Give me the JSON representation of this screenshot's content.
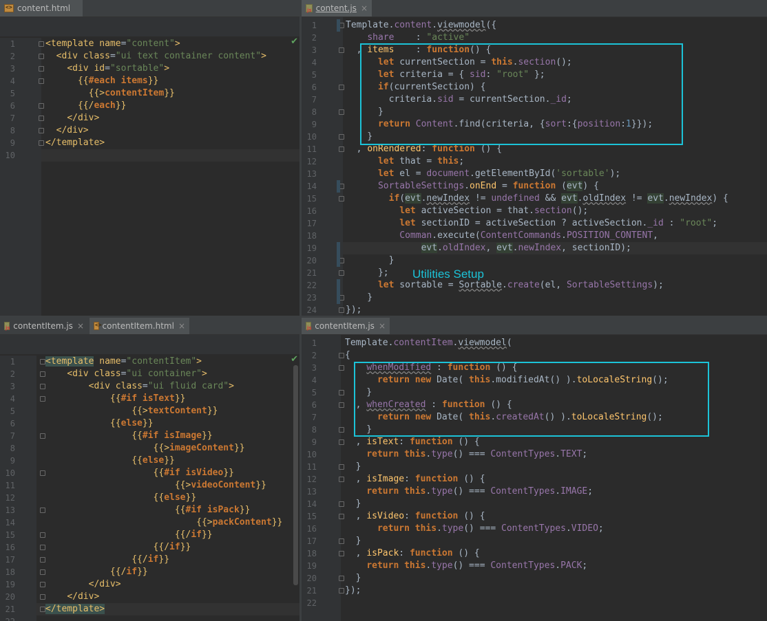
{
  "panes": {
    "top_left": {
      "tabs": [
        {
          "label": "content.html",
          "icon": "html-file-icon",
          "active": true
        }
      ],
      "lines": [
        "<span class='tag'>&lt;template</span> <span class='tag'>name</span>=<span class='str'>\"content\"</span><span class='tag'>&gt;</span>",
        "  <span class='tag'>&lt;div</span> <span class='tag'>class</span>=<span class='str'>\"ui text container content\"</span><span class='tag'>&gt;</span>",
        "    <span class='tag'>&lt;div</span> <span class='tag'>id</span>=<span class='str'>\"sortable\"</span><span class='tag'>&gt;</span>",
        "      <span class='tag'>{{</span><span class='kw'>#each</span> <span class='kw'>items</span><span class='tag'>}}</span>",
        "        <span class='tag'>{{&gt;</span><span class='kw'>contentItem</span><span class='tag'>}}</span>",
        "      <span class='tag'>{{/</span><span class='kw'>each</span><span class='tag'>}}</span>",
        "    <span class='tag'>&lt;/div&gt;</span>",
        "  <span class='tag'>&lt;/div&gt;</span>",
        "<span class='tag'>&lt;/template&gt;</span>",
        ""
      ]
    },
    "top_right": {
      "tabs": [
        {
          "label": "content.js",
          "icon": "js-file-icon",
          "active": true
        }
      ],
      "lines": [
        "Template.<span class='fld'>content</span>.<span class='ul'>viewmodel</span>({",
        "    <span class='fld'>share</span>    : <span class='str'>\"active\"</span>",
        "  , <span class='fn'>items</span>    : <span class='kw'>function</span>() {",
        "      <span class='kw'>let</span> currentSection = <span class='kw'>this</span>.<span class='fld'>section</span>();",
        "      <span class='kw'>let</span> criteria = { <span class='fld'>sid</span>: <span class='str'>\"root\"</span> };",
        "      <span class='kw'>if</span>(currentSection) {",
        "        criteria.<span class='fld'>sid</span> = currentSection.<span class='fld'>_id</span>;",
        "      }",
        "      <span class='kw'>return</span> <span class='cls'>Content</span>.find(criteria, {<span class='fld'>sort</span>:{<span class='fld'>position</span>:<span class='num'>1</span>}});",
        "    }",
        "  , <span class='fn'>onRendered</span>: <span class='kw'>function</span> () {",
        "      <span class='kw'>let</span> that = <span class='kw'>this</span>;",
        "      <span class='kw'>let</span> el = <span class='cls'>document</span>.getElementById(<span class='str'>'sortable'</span>);",
        "      <span class='cls'>SortableSettings</span>.<span class='fn'>onEnd</span> = <span class='kw'>function</span> (<span class='hl-param'>evt</span>) {",
        "        <span class='kw'>if</span>(<span class='hl-param'>evt</span>.<span class='ul'>newIndex</span> != <span class='cls'>undefined</span> &amp;&amp; <span class='hl-param'>evt</span>.<span class='ul'>oldIndex</span> != <span class='hl-param'>evt</span>.<span class='ul'>newIndex</span>) {",
        "          <span class='kw'>let</span> activeSection = that.<span class='fld'>section</span>();",
        "          <span class='kw'>let</span> sectionID = activeSection ? activeSection.<span class='fld'>_id</span> : <span class='str'>\"root\"</span>;",
        "          <span class='cls'>Comman</span>.execute(<span class='cls'>ContentCommands</span>.<span class='fld'>POSITION_CONTENT</span>,",
        "              <span class='hl-param'>evt</span>.<span class='fld'>oldIndex</span>, <span class='hl-param'>evt</span>.<span class='fld'>newIndex</span>, sectionID);",
        "        }",
        "      };",
        "      <span class='kw'>let</span> sortable = <span class='ul'>Sortable</span>.<span class='fld'>create</span>(el, <span class='cls'>SortableSettings</span>);",
        "    }",
        "});"
      ],
      "annotation": "Utilities Setup"
    },
    "bottom_left": {
      "tabs": [
        {
          "label": "contentItem.js",
          "icon": "js-file-icon",
          "active": false
        },
        {
          "label": "contentItem.html",
          "icon": "html-file-icon",
          "active": true
        }
      ],
      "lines": [
        "<span class='tag' style='background:#3b514d'>&lt;template</span> <span class='tag'>name</span>=<span class='str'>\"contentItem\"</span><span class='tag'>&gt;</span>",
        "    <span class='tag'>&lt;div</span> <span class='tag'>class</span>=<span class='str'>\"ui container\"</span><span class='tag'>&gt;</span>",
        "        <span class='tag'>&lt;div</span> <span class='tag'>class</span>=<span class='str'>\"ui fluid card\"</span><span class='tag'>&gt;</span>",
        "            <span class='tag'>{{</span><span class='kw'>#if</span> <span class='kw'>isText</span><span class='tag'>}}</span>",
        "                <span class='tag'>{{&gt;</span><span class='kw'>textContent</span><span class='tag'>}}</span>",
        "            <span class='tag'>{{</span><span class='kw'>else</span><span class='tag'>}}</span>",
        "                <span class='tag'>{{</span><span class='kw'>#if</span> <span class='kw'>isImage</span><span class='tag'>}}</span>",
        "                    <span class='tag'>{{&gt;</span><span class='kw'>imageContent</span><span class='tag'>}}</span>",
        "                <span class='tag'>{{</span><span class='kw'>else</span><span class='tag'>}}</span>",
        "                    <span class='tag'>{{</span><span class='kw'>#if</span> <span class='kw'>isVideo</span><span class='tag'>}}</span>",
        "                        <span class='tag'>{{&gt;</span><span class='kw'>videoContent</span><span class='tag'>}}</span>",
        "                    <span class='tag'>{{</span><span class='kw'>else</span><span class='tag'>}}</span>",
        "                        <span class='tag'>{{</span><span class='kw'>#if</span> <span class='kw'>isPack</span><span class='tag'>}}</span>",
        "                            <span class='tag'>{{&gt;</span><span class='kw'>packContent</span><span class='tag'>}}</span>",
        "                        <span class='tag'>{{/</span><span class='kw'>if</span><span class='tag'>}}</span>",
        "                    <span class='tag'>{{/</span><span class='kw'>if</span><span class='tag'>}}</span>",
        "                <span class='tag'>{{/</span><span class='kw'>if</span><span class='tag'>}}</span>",
        "            <span class='tag'>{{/</span><span class='kw'>if</span><span class='tag'>}}</span>",
        "        <span class='tag'>&lt;/div&gt;</span>",
        "    <span class='tag'>&lt;/div&gt;</span>",
        "<span class='tag' style='background:#3b514d'>&lt;/template&gt;</span>",
        ""
      ]
    },
    "bottom_right": {
      "tabs": [
        {
          "label": "contentItem.js",
          "icon": "js-file-icon",
          "active": true
        }
      ],
      "lines": [
        "Template.<span class='fld'>contentItem</span>.<span class='ul'>viewmodel</span>(",
        "{",
        "    <span class='fld ul'>whenModified</span> : <span class='kw'>function</span> () {",
        "      <span class='kw'>return</span> <span class='kw'>new</span> Date( <span class='kw'>this</span>.modifiedAt() ).<span class='fn'>toLocaleString</span>();",
        "    }",
        "  , <span class='fld ul'>whenCreated</span> : <span class='kw'>function</span> () {",
        "      <span class='kw'>return</span> <span class='kw'>new</span> Date( <span class='kw'>this</span>.<span class='fld'>createdAt</span>() ).<span class='fn'>toLocaleString</span>();",
        "    }",
        "  , <span class='fn'>isText</span>: <span class='kw'>function</span> () {",
        "    <span class='kw'>return</span> <span class='kw'>this</span>.<span class='fld'>type</span>() === <span class='cls'>ContentTypes</span>.<span class='fld'>TEXT</span>;",
        "  }",
        "  , <span class='fn'>isImage</span>: <span class='kw'>function</span> () {",
        "    <span class='kw'>return</span> <span class='kw'>this</span>.<span class='fld'>type</span>() === <span class='cls'>ContentTypes</span>.<span class='fld'>IMAGE</span>;",
        "  }",
        "  , <span class='fn'>isVideo</span>: <span class='kw'>function</span> () {",
        "      <span class='kw'>return</span> <span class='kw'>this</span>.<span class='fld'>type</span>() === <span class='cls'>ContentTypes</span>.<span class='fld'>VIDEO</span>;",
        "  }",
        "  , <span class='fn'>isPack</span>: <span class='kw'>function</span> () {",
        "    <span class='kw'>return</span> <span class='kw'>this</span>.<span class='fld'>type</span>() === <span class='cls'>ContentTypes</span>.<span class='fld'>PACK</span>;",
        "  }",
        "});",
        ""
      ]
    }
  },
  "colors": {
    "annotation_box": "#1cc3d8",
    "background": "#2b2b2b",
    "gutter": "#313335"
  }
}
